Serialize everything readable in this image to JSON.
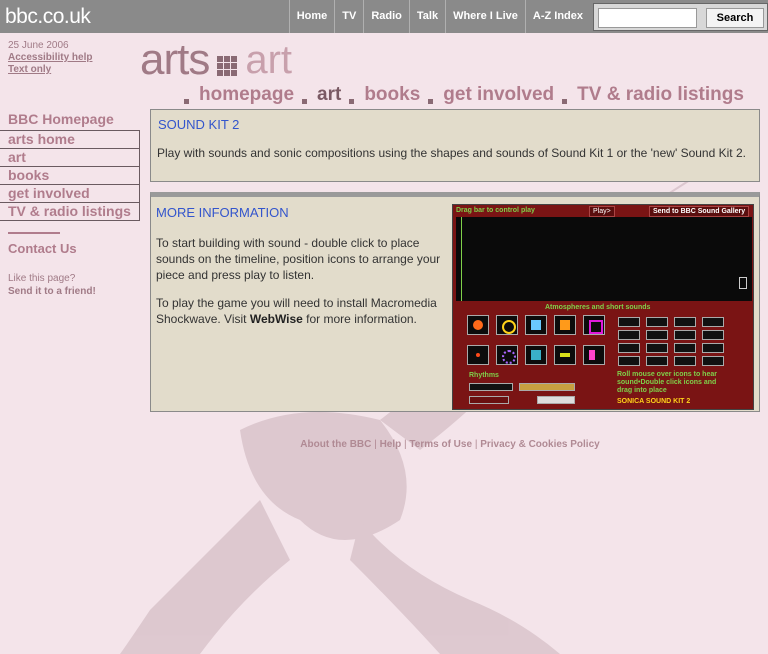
{
  "header": {
    "logo": "bbc.co.uk",
    "nav": [
      "Home",
      "TV",
      "Radio",
      "Talk",
      "Where I Live",
      "A-Z Index"
    ],
    "search_button": "Search"
  },
  "left": {
    "date": "25 June 2006",
    "accessibility": "Accessibility help",
    "text_only": "Text only",
    "bbc_homepage": "BBC Homepage",
    "menu": [
      "arts home",
      "art",
      "books",
      "get involved",
      "TV & radio listings"
    ],
    "contact": "Contact Us",
    "like": "Like this page?",
    "send": "Send it to a friend!"
  },
  "brand": {
    "arts": "arts",
    "art": "art"
  },
  "sitenav": [
    "homepage",
    "art",
    "books",
    "get involved",
    "TV & radio listings"
  ],
  "soundkit": {
    "title": "SOUND KIT 2",
    "body": "Play with sounds and sonic compositions using the shapes and sounds of Sound Kit 1 or the 'new' Sound Kit 2."
  },
  "more": {
    "title": "MORE INFORMATION",
    "p1": "To start building with sound - double click to place sounds on the timeline, position icons to arrange your piece and press play to listen.",
    "p2_pre": "To play the game you will need to install Macromedia Shockwave. Visit ",
    "p2_link": "WebWise",
    "p2_post": " for more information."
  },
  "game": {
    "drag": "Drag bar to control play",
    "play": "Play>",
    "send": "Send to BBC Sound Gallery",
    "atmospheres": "Atmospheres and short sounds",
    "rhythms": "Rhythms",
    "roll": "Roll mouse over icons to hear sound•Double click icons and drag into place",
    "sonica": "SONICA SOUND KIT 2"
  },
  "footer": [
    "About the BBC",
    "Help",
    "Terms of Use",
    "Privacy & Cookies Policy"
  ]
}
